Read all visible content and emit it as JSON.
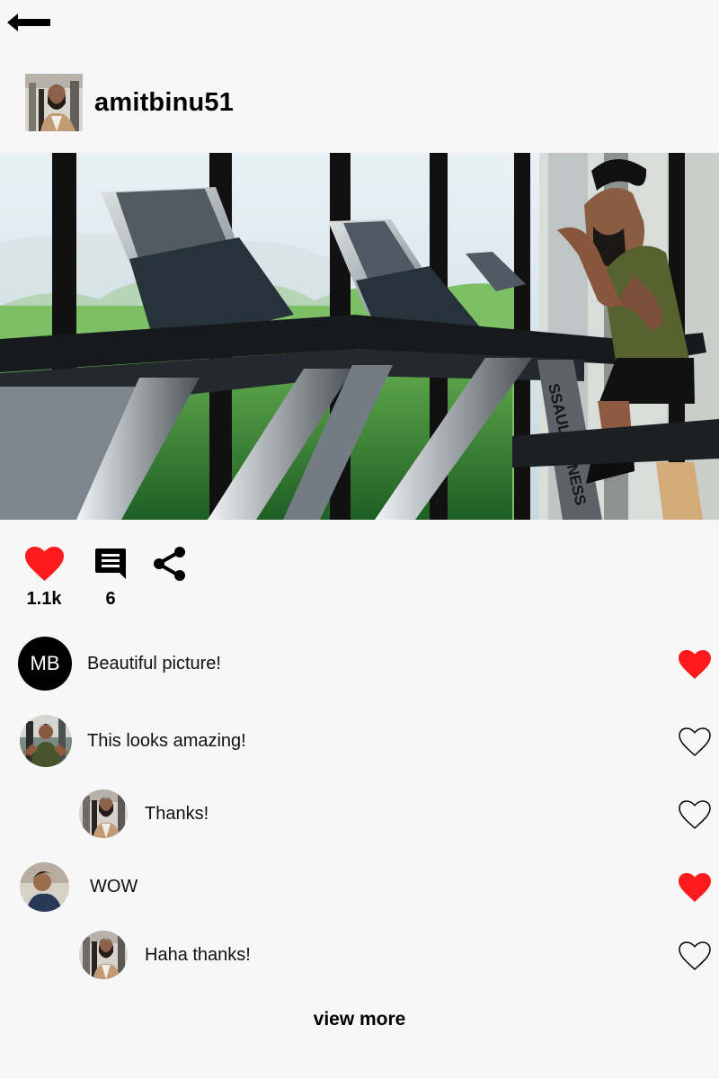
{
  "header": {
    "back_icon": "arrow-left-icon",
    "username": "amitbinu51"
  },
  "post": {
    "image_alt": "photo",
    "likes_count": "1.1k",
    "comments_count": "6",
    "like_icon": "heart-filled-icon",
    "comment_icon": "comment-icon",
    "share_icon": "share-icon",
    "image_text": "SSAULTFITNESS"
  },
  "comments": [
    {
      "avatar_initials": "MB",
      "text": "Beautiful picture!",
      "liked": true
    },
    {
      "text": "This looks amazing!",
      "liked": false
    },
    {
      "reply": true,
      "text": "Thanks!",
      "liked": false
    },
    {
      "text": "WOW",
      "liked": true
    },
    {
      "reply": true,
      "text": "Haha thanks!",
      "liked": false
    }
  ],
  "footer": {
    "view_more": "view more"
  },
  "colors": {
    "background": "#f7f7f7",
    "like_red": "#ff1b1b",
    "text": "#000000"
  }
}
